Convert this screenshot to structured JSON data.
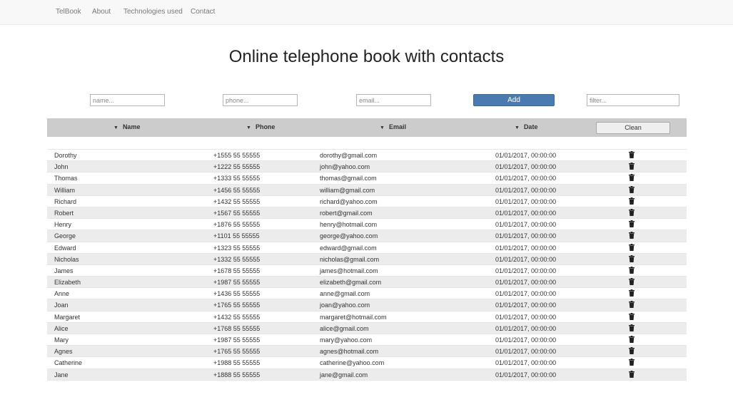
{
  "nav": {
    "items": [
      {
        "label": "TelBook"
      },
      {
        "label": "About"
      },
      {
        "label": "Technologies used"
      },
      {
        "label": "Contact"
      }
    ]
  },
  "page_title": "Online telephone book with contacts",
  "form": {
    "name_placeholder": "name...",
    "phone_placeholder": "phone...",
    "email_placeholder": "email...",
    "add_label": "Add",
    "filter_placeholder": "filter..."
  },
  "table": {
    "sort_icon": "caret-down-icon",
    "delete_icon": "trash-icon",
    "headers": {
      "name": "Name",
      "phone": "Phone",
      "email": "Email",
      "date": "Date"
    },
    "clean_label": "Clean",
    "rows": [
      {
        "name": "Dorothy",
        "phone": "+1555 55 55555",
        "email": "dorothy@gmail.com",
        "date": "01/01/2017, 00:00:00"
      },
      {
        "name": "John",
        "phone": "+1222 55 55555",
        "email": "john@yahoo.com",
        "date": "01/01/2017, 00:00:00"
      },
      {
        "name": "Thomas",
        "phone": "+1333 55 55555",
        "email": "thomas@gmail.com",
        "date": "01/01/2017, 00:00:00"
      },
      {
        "name": "William",
        "phone": "+1456 55 55555",
        "email": "william@gmail.com",
        "date": "01/01/2017, 00:00:00"
      },
      {
        "name": "Richard",
        "phone": "+1432 55 55555",
        "email": "richard@yahoo.com",
        "date": "01/01/2017, 00:00:00"
      },
      {
        "name": "Robert",
        "phone": "+1567 55 55555",
        "email": "robert@gmail.com",
        "date": "01/01/2017, 00:00:00"
      },
      {
        "name": "Henry",
        "phone": "+1876 55 55555",
        "email": "henry@hotmail.com",
        "date": "01/01/2017, 00:00:00"
      },
      {
        "name": "George",
        "phone": "+1101 55 55555",
        "email": "george@yahoo.com",
        "date": "01/01/2017, 00:00:00"
      },
      {
        "name": "Edward",
        "phone": "+1323 55 55555",
        "email": "edward@gmail.com",
        "date": "01/01/2017, 00:00:00"
      },
      {
        "name": "Nicholas",
        "phone": "+1332 55 55555",
        "email": "nicholas@gmail.com",
        "date": "01/01/2017, 00:00:00"
      },
      {
        "name": "James",
        "phone": "+1678 55 55555",
        "email": "james@hotmail.com",
        "date": "01/01/2017, 00:00:00"
      },
      {
        "name": "Elizabeth",
        "phone": "+1987 55 55555",
        "email": "elizabeth@gmail.com",
        "date": "01/01/2017, 00:00:00"
      },
      {
        "name": "Anne",
        "phone": "+1436 55 55555",
        "email": "anne@gmail.com",
        "date": "01/01/2017, 00:00:00"
      },
      {
        "name": "Joan",
        "phone": "+1765 55 55555",
        "email": "joan@yahoo.com",
        "date": "01/01/2017, 00:00:00"
      },
      {
        "name": "Margaret",
        "phone": "+1432 55 55555",
        "email": "margaret@hotmail.com",
        "date": "01/01/2017, 00:00:00"
      },
      {
        "name": "Alice",
        "phone": "+1768 55 55555",
        "email": "alice@gmail.com",
        "date": "01/01/2017, 00:00:00"
      },
      {
        "name": "Mary",
        "phone": "+1987 55 55555",
        "email": "mary@yahoo.com",
        "date": "01/01/2017, 00:00:00"
      },
      {
        "name": "Agnes",
        "phone": "+1765 55 55555",
        "email": "agnes@hotmail.com",
        "date": "01/01/2017, 00:00:00"
      },
      {
        "name": "Catherine",
        "phone": "+1988 55 55555",
        "email": "catherine@yahoo.com",
        "date": "01/01/2017, 00:00:00"
      },
      {
        "name": "Jane",
        "phone": "+1888 55 55555",
        "email": "jane@gmail.com",
        "date": "01/01/2017, 00:00:00"
      }
    ]
  },
  "colors": {
    "add_button": "#4a7ab0",
    "header_bg": "#cccccc",
    "row_alt_bg": "#ececec",
    "navbar_bg": "#f8f8f8"
  }
}
